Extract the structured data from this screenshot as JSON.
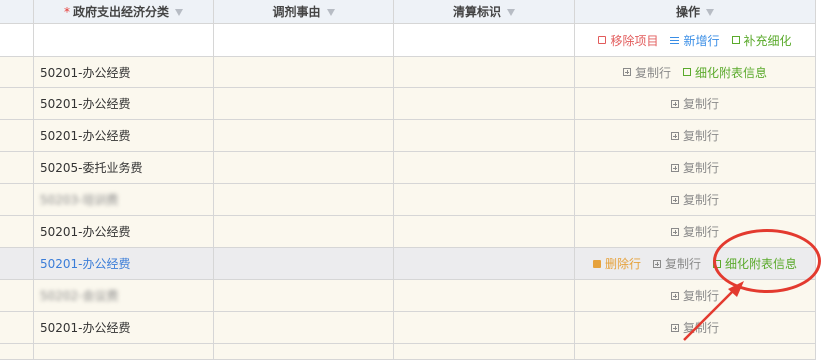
{
  "header": {
    "required_mark": "*",
    "columns": [
      "政府支出经济分类",
      "调剂事由",
      "清算标识",
      "操作"
    ]
  },
  "toolbar": {
    "remove_label": "移除项目",
    "add_row_label": "新增行",
    "supplement_label": "补充细化"
  },
  "actions": {
    "copy_row": "复制行",
    "detail_info": "细化附表信息",
    "delete_row": "删除行"
  },
  "rows": [
    {
      "category": "50201-办公经费",
      "blurred": false,
      "actions": [
        "copy",
        "detail"
      ]
    },
    {
      "category": "50201-办公经费",
      "blurred": false,
      "actions": [
        "copy"
      ]
    },
    {
      "category": "50201-办公经费",
      "blurred": false,
      "actions": [
        "copy"
      ]
    },
    {
      "category": "50205-委托业务费",
      "blurred": false,
      "actions": [
        "copy"
      ]
    },
    {
      "category": "50203-培训费",
      "blurred": true,
      "actions": [
        "copy"
      ]
    },
    {
      "category": "50201-办公经费",
      "blurred": false,
      "actions": [
        "copy"
      ]
    },
    {
      "category": "50201-办公经费",
      "blurred": false,
      "selected": true,
      "actions": [
        "delete",
        "copy",
        "detail"
      ]
    },
    {
      "category": "50202-会议费",
      "blurred": true,
      "actions": [
        "copy"
      ]
    },
    {
      "category": "50201-办公经费",
      "blurred": false,
      "actions": [
        "copy"
      ]
    },
    {
      "category": "",
      "blurred": false,
      "actions": []
    }
  ],
  "colors": {
    "annotation": "#e33a2f",
    "accent_blue": "#3a8ee6",
    "accent_green": "#5aaa2b",
    "accent_red": "#e25b5b"
  }
}
